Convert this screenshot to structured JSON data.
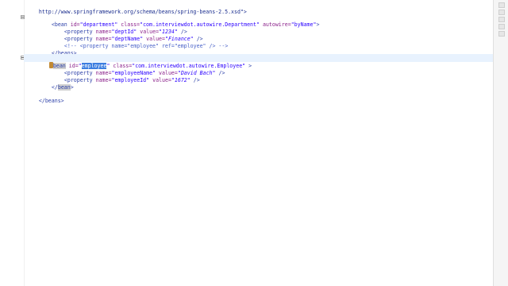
{
  "editor": {
    "lines": {
      "l0_url": "http://www.springframework.org/schema/beans/spring-beans-2.5.xsd\">",
      "l1_open": "<bean",
      "l1_id_attr": "id=",
      "l1_id_val": "\"department\"",
      "l1_class_attr": "class=",
      "l1_class_val": "\"com.interviewdot.autowire.Department\"",
      "l1_aw_attr": "autowire=",
      "l1_aw_val": "\"byName\"",
      "l1_close": ">",
      "l2_open": "<property",
      "l2_name_attr": "name=",
      "l2_name_val": "\"deptId\"",
      "l2_value_attr": "value=",
      "l2_value_val": "\"1234\"",
      "l2_close": "/>",
      "l3_open": "<property",
      "l3_name_attr": "name=",
      "l3_name_val": "\"deptName\"",
      "l3_value_attr": "value=",
      "l3_value_val": "\"Finance\"",
      "l3_close": "/>",
      "l4_comment": "<!-- <property name=\"employee\" ref=\"employee\" /> -->",
      "l5": "</beans>",
      "l6_open_pre": "",
      "l6_bean_b": "bean",
      "l6_id_attr": "id=",
      "l6_id_q1": "\"",
      "l6_id_sel": "employee",
      "l6_id_q2": "\"",
      "l6_class_attr": "class=",
      "l6_class_val": "\"com.interviewdot.autowire.Employee\"",
      "l6_close": ">",
      "l7_open": "<property",
      "l7_name_attr": "name=",
      "l7_name_val": "\"employeeName\"",
      "l7_value_attr": "value=",
      "l7_value_val": "\"David Bach\"",
      "l7_close": "/>",
      "l8_open": "<property",
      "l8_name_attr": "name=",
      "l8_name_val": "\"employeeId\"",
      "l8_value_attr": "value=",
      "l8_value_val": "\"1672\"",
      "l8_close": "/>",
      "l9_pre": "</",
      "l9_bean": "bean",
      "l9_close": ">",
      "l10": "</beans>"
    }
  }
}
